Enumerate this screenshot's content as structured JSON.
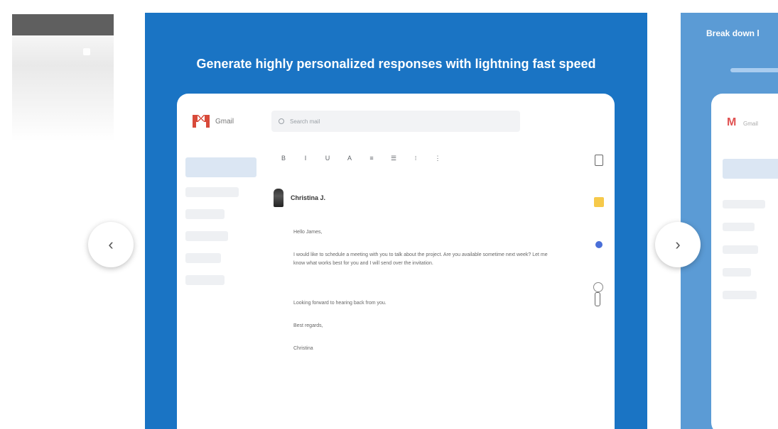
{
  "main_slide": {
    "title": "Generate highly personalized responses with lightning fast speed"
  },
  "right_slide": {
    "title": "Break down l"
  },
  "mail": {
    "app_name": "Gmail",
    "search_placeholder": "Search mail",
    "toolbar_icons": [
      "B",
      "I",
      "U",
      "A",
      "≡",
      "☰",
      "⁝",
      "⋮",
      "≔",
      "⌫",
      "⋯"
    ],
    "sender": "Christina J.",
    "greeting": "Hello James,",
    "paragraph": "I would like to schedule a meeting with you to talk about the project. Are you available sometime next week? Let me know what works best for you and I will send over the invitation.",
    "closing_line": "Looking forward to hearing back from you.",
    "signoff": "Best regards,",
    "signature": "Christina"
  },
  "nav": {
    "prev_icon": "chevron-left-icon",
    "next_icon": "chevron-right-icon",
    "prev_glyph": "‹",
    "next_glyph": "›"
  },
  "colors": {
    "slide_blue": "#1a74c4",
    "slide_blue_light": "#5b9bd5",
    "gmail_red": "#d84a3a"
  }
}
